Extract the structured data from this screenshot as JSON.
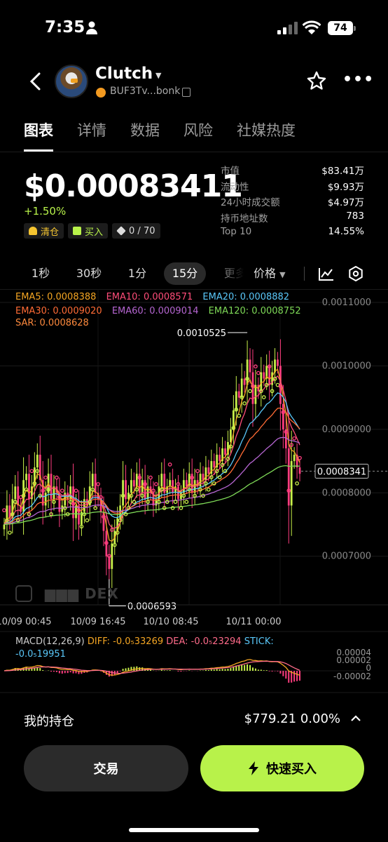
{
  "status": {
    "time": "7:35",
    "battery": "74"
  },
  "header": {
    "name": "Clutch",
    "address": "BUF3Tv...bonk"
  },
  "tabs": [
    "图表",
    "详情",
    "数据",
    "风险",
    "社媒热度"
  ],
  "price": {
    "value": "$0.00083411",
    "change": "+1.50%"
  },
  "badges": {
    "clear": "清仓",
    "buy": "买入",
    "count": "0 / 70"
  },
  "stats": [
    {
      "k": "市值",
      "v": "$83.41万"
    },
    {
      "k": "流动性",
      "v": "$9.93万"
    },
    {
      "k": "24小时成交额",
      "v": "$4.97万"
    },
    {
      "k": "持币地址数",
      "v": "783"
    },
    {
      "k": "Top 10",
      "v": "14.55%"
    }
  ],
  "intervals": {
    "items": [
      "1秒",
      "30秒",
      "1分",
      "15分",
      "更多"
    ],
    "active": "15分",
    "price_label": "价格"
  },
  "legend": {
    "ema5": "EMA5: 0.0008388",
    "ema10": "EMA10: 0.0008571",
    "ema20": "EMA20: 0.0008882",
    "ema30": "EMA30: 0.0009020",
    "ema60": "EMA60: 0.0009014",
    "ema120": "EMA120: 0.0008752",
    "sar": "SAR: 0.0008628"
  },
  "colors": {
    "ema5": "#f5a623",
    "ema10": "#ff4d79",
    "ema20": "#5ac8fa",
    "ema30": "#ff6b35",
    "ema60": "#b666d2",
    "ema120": "#7ed957",
    "sar": "#ff8a3d",
    "up": "#c8f04a",
    "down": "#ff3d7f",
    "dif": "#f5a623",
    "dea": "#ff6b8a",
    "stick": "#5ac8fa"
  },
  "chart_data": {
    "type": "candlestick",
    "yaxis_ticks": [
      "0.0011000",
      "0.0010000",
      "0.0009000",
      "0.0008000",
      "0.0007000"
    ],
    "ylim": [
      0.00064,
      0.00111
    ],
    "x_ticks": [
      "10/09 00:45",
      "10/09 16:45",
      "10/10 08:45",
      "10/11 00:00"
    ],
    "current_price_label": "0.0008341",
    "current_price": 0.0008341,
    "high_label": "0.0010525",
    "high": 0.0010525,
    "low_label": "0.0006593",
    "low": 0.0006593,
    "watermark": "DEX",
    "closes": [
      0.00075,
      0.00078,
      0.00076,
      0.00079,
      0.00081,
      0.00078,
      0.00077,
      0.00082,
      0.00083,
      0.00079,
      0.00081,
      0.00084,
      0.00086,
      0.00082,
      0.00078,
      0.0008,
      0.00083,
      0.00079,
      0.00081,
      0.0008,
      0.00077,
      0.00078,
      0.0008,
      0.00079,
      0.00081,
      0.00076,
      0.00078,
      0.00075,
      0.00077,
      0.00079,
      0.00078,
      0.00081,
      0.00083,
      0.0008,
      0.00079,
      0.00077,
      0.00074,
      0.0007,
      0.00068,
      0.00072,
      0.00074,
      0.00076,
      0.00078,
      0.00082,
      0.00079,
      0.0008,
      0.00082,
      0.00081,
      0.00083,
      0.0008,
      0.00082,
      0.00079,
      0.00081,
      0.0008,
      0.00078,
      0.00079,
      0.00081,
      0.00083,
      0.0008,
      0.00081,
      0.00082,
      0.0008,
      0.00081,
      0.00079,
      0.0008,
      0.00082,
      0.00081,
      0.00083,
      0.0008,
      0.00082,
      0.00081,
      0.00083,
      0.00082,
      0.00084,
      0.00083,
      0.00085,
      0.00084,
      0.00086,
      0.00085,
      0.00087,
      0.00086,
      0.00088,
      0.0009,
      0.00093,
      0.00096,
      0.00095,
      0.00098,
      0.00097,
      0.00101,
      0.00099,
      0.00094,
      0.00097,
      0.00096,
      0.00099,
      0.00098,
      0.001,
      0.00097,
      0.00099,
      0.00101,
      0.001,
      0.00094,
      0.0009,
      0.00087,
      0.00078,
      0.00085,
      0.00086,
      0.00084,
      0.00083
    ],
    "macd_ticks": [
      "0.00004",
      "0.00002",
      "0",
      "-0.00002"
    ]
  },
  "macd_legend": {
    "title": "MACD(12,26,9)",
    "diff": "DIFF: -0.0₅332 69",
    "dea": "DEA: -0.0₅232 94",
    "stick": "STICK:",
    "stick_val": "-0.0₅199 51"
  },
  "macd_text": {
    "diff": "DIFF: -0.0₅33269",
    "dea": "DEA: -0.0₅23294",
    "stick": "STICK:",
    "stick_val": "-0.0₅19951"
  },
  "holdings": {
    "label": "我的持仓",
    "value": "$779.21 0.00%"
  },
  "buttons": {
    "trade": "交易",
    "buy": "快速买入"
  }
}
